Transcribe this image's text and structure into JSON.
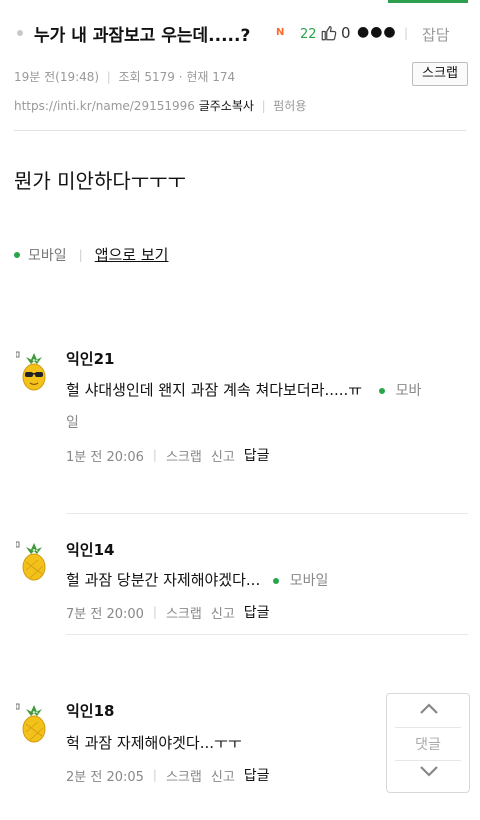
{
  "post": {
    "title": "누가 내 과잠보고 우는데.....?",
    "new_badge": "N",
    "comment_count": "22",
    "like_count": "0",
    "more_label": "●●●",
    "category": "잡담",
    "time": "19분 전(19:48)",
    "views_label": "조회 5179 · 현재 174",
    "scrap_button": "스크랩",
    "url": "https://inti.kr/name/29151996",
    "copy_label": "글주소복사",
    "permission_label": "펌허용",
    "body": "뭔가 미안하다ㅜㅜㅜ",
    "mobile_label": "모바일",
    "app_link": "앱으로 보기"
  },
  "comments": [
    {
      "nick": "익인21",
      "text": "헐 샤대생인데 왠지 과잠 계속 쳐다보더라.....ㅠ",
      "mobile_label": "모바",
      "mobile_tail": "일",
      "time": "1분 전 20:06",
      "scrap": "스크랩",
      "report": "신고",
      "reply": "답글"
    },
    {
      "nick": "익인14",
      "text": "헐 과잠 당분간 자제해야겠다...",
      "mobile_label": "모바일",
      "time": "7분 전 20:00",
      "scrap": "스크랩",
      "report": "신고",
      "reply": "답글"
    },
    {
      "nick": "익인18",
      "text": "헉 과잠 자제해야겟다...ㅜㅜ",
      "time": "2분 전 20:05",
      "scrap": "스크랩",
      "report": "신고",
      "reply": "답글"
    }
  ],
  "floater": {
    "label": "댓글",
    "up_icon": "chevron-up-icon",
    "down_icon": "chevron-down-icon"
  },
  "colors": {
    "accent_green": "#27a549",
    "new_orange": "#ff6a2b"
  }
}
